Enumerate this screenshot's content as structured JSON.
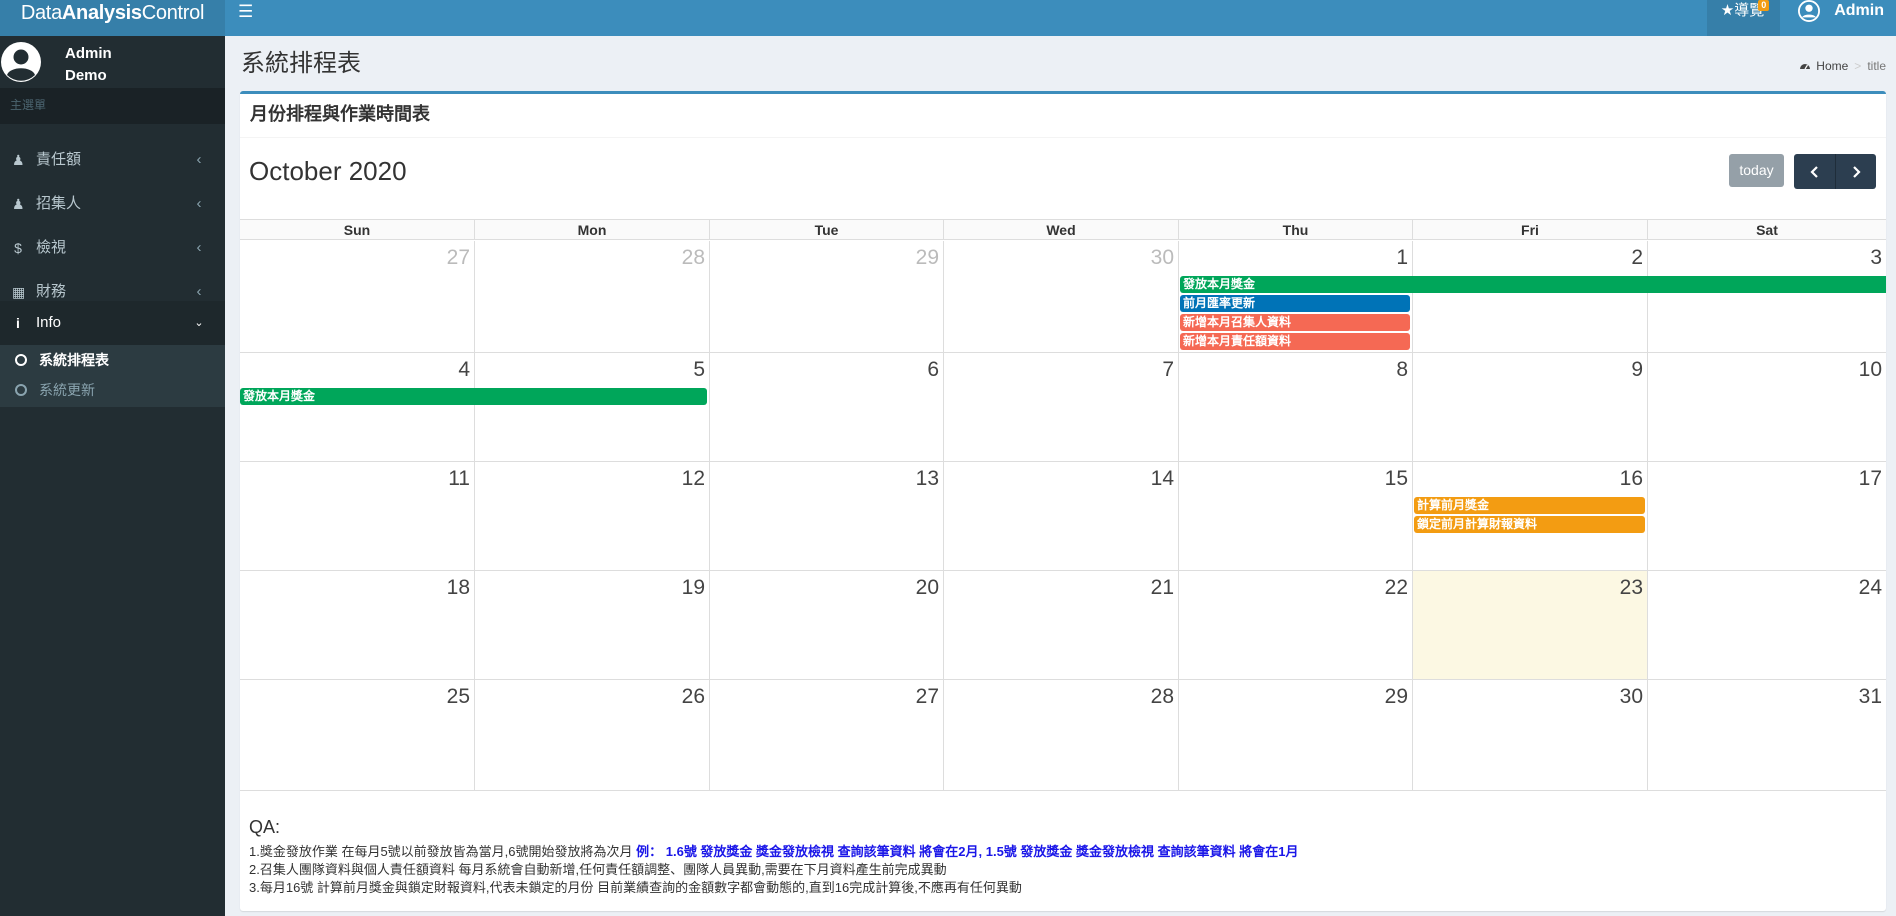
{
  "brand": {
    "part1": "Data",
    "part2": "Analysis",
    "part3": "Control"
  },
  "header": {
    "guide_label": "導覽",
    "guide_badge": "0",
    "user_name": "Admin"
  },
  "sidebar": {
    "user_name": "Admin",
    "user_role": "Demo",
    "menu_header": "主選單",
    "items": [
      {
        "label": "責任額",
        "icon": "person-icon"
      },
      {
        "label": "招集人",
        "icon": "person-icon"
      },
      {
        "label": "檢視",
        "icon": "dollar-icon"
      },
      {
        "label": "財務",
        "icon": "calculator-icon"
      },
      {
        "label": "Info",
        "icon": "info-icon"
      }
    ],
    "subitems": [
      {
        "label": "系統排程表"
      },
      {
        "label": "系統更新"
      }
    ]
  },
  "page": {
    "title": "系統排程表",
    "breadcrumb": [
      "Home",
      "title"
    ]
  },
  "box": {
    "title": "月份排程與作業時間表"
  },
  "calendar": {
    "month_title": "October 2020",
    "today_label": "today",
    "dow": [
      "Sun",
      "Mon",
      "Tue",
      "Wed",
      "Thu",
      "Fri",
      "Sat"
    ],
    "weeks": [
      [
        {
          "n": "27",
          "other": true
        },
        {
          "n": "28",
          "other": true
        },
        {
          "n": "29",
          "other": true
        },
        {
          "n": "30",
          "other": true
        },
        {
          "n": "1"
        },
        {
          "n": "2"
        },
        {
          "n": "3"
        }
      ],
      [
        {
          "n": "4"
        },
        {
          "n": "5"
        },
        {
          "n": "6"
        },
        {
          "n": "7"
        },
        {
          "n": "8"
        },
        {
          "n": "9"
        },
        {
          "n": "10"
        }
      ],
      [
        {
          "n": "11"
        },
        {
          "n": "12"
        },
        {
          "n": "13"
        },
        {
          "n": "14"
        },
        {
          "n": "15"
        },
        {
          "n": "16"
        },
        {
          "n": "17"
        }
      ],
      [
        {
          "n": "18"
        },
        {
          "n": "19"
        },
        {
          "n": "20"
        },
        {
          "n": "21"
        },
        {
          "n": "22"
        },
        {
          "n": "23",
          "today": true
        },
        {
          "n": "24"
        }
      ],
      [
        {
          "n": "25"
        },
        {
          "n": "26"
        },
        {
          "n": "27"
        },
        {
          "n": "28"
        },
        {
          "n": "29"
        },
        {
          "n": "30"
        },
        {
          "n": "31"
        }
      ]
    ],
    "events": [
      {
        "title": "發放本月獎金",
        "week": 0,
        "startDay": 4,
        "endDay": 6,
        "continues": true,
        "color": "#00a65a"
      },
      {
        "title": "前月匯率更新",
        "week": 0,
        "startDay": 4,
        "endDay": 4,
        "color": "#0073b7"
      },
      {
        "title": "新增本月召集人資料",
        "week": 0,
        "startDay": 4,
        "endDay": 4,
        "color": "#f56954"
      },
      {
        "title": "新增本月責任額資料",
        "week": 0,
        "startDay": 4,
        "endDay": 4,
        "color": "#f56954"
      },
      {
        "title": "發放本月獎金",
        "week": 1,
        "startDay": 0,
        "endDay": 1,
        "color": "#00a65a"
      },
      {
        "title": "計算前月獎金",
        "week": 2,
        "startDay": 5,
        "endDay": 5,
        "color": "#f39c12"
      },
      {
        "title": "鎖定前月計算財報資料",
        "week": 2,
        "startDay": 5,
        "endDay": 5,
        "color": "#f39c12"
      }
    ]
  },
  "qa": {
    "title": "QA:",
    "line1_plain": "1.獎金發放作業 在每月5號以前發放皆為當月,6號開始發放將為次月 ",
    "line1_highlight": "例： 1.6號 發放獎金 獎金發放檢視 查詢該筆資料 將會在2月, 1.5號 發放獎金 獎金發放檢視 查詢該筆資料 將會在1月",
    "line2": "2.召集人團隊資料與個人責任額資料 每月系統會自動新增,任何責任額調整、團隊人員異動,需要在下月資料產生前完成異動",
    "line3": "3.每月16號 計算前月獎金與鎖定財報資料,代表未鎖定的月份 目前業績查詢的金額數字都會動態的,直到16完成計算後,不應再有任何異動"
  },
  "colors": {
    "header": "#3c8dbc",
    "sidebar": "#222d32",
    "green": "#00a65a",
    "blue": "#0073b7",
    "red": "#f56954",
    "orange": "#f39c12",
    "today_bg": "#fcf8e3"
  }
}
